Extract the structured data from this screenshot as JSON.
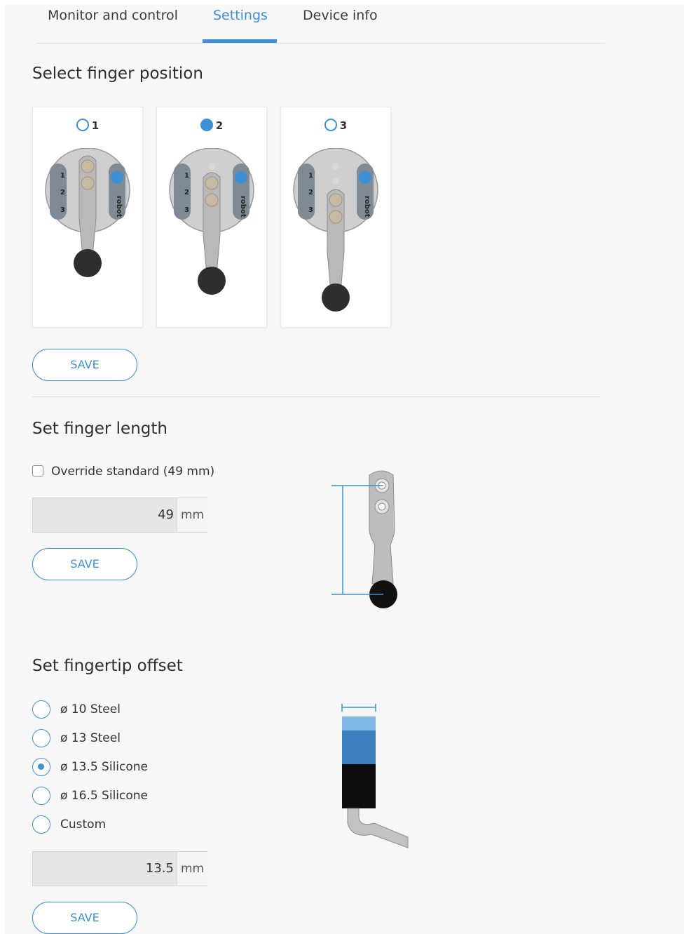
{
  "tabs": [
    {
      "label": "Monitor and control",
      "active": false
    },
    {
      "label": "Settings",
      "active": true
    },
    {
      "label": "Device info",
      "active": false
    }
  ],
  "finger_position": {
    "title": "Select finger position",
    "options": [
      {
        "label": "1",
        "selected": false,
        "brand": "robot"
      },
      {
        "label": "2",
        "selected": true,
        "brand": "robot"
      },
      {
        "label": "3",
        "selected": false,
        "brand": "robot"
      }
    ],
    "save_label": "SAVE"
  },
  "finger_length": {
    "title": "Set finger length",
    "override_label": "Override standard (49 mm)",
    "override_checked": false,
    "value": "49",
    "unit": "mm",
    "save_label": "SAVE"
  },
  "fingertip_offset": {
    "title": "Set fingertip offset",
    "options": [
      {
        "label": "ø 10 Steel",
        "selected": false
      },
      {
        "label": "ø 13 Steel",
        "selected": false
      },
      {
        "label": "ø 13.5 Silicone",
        "selected": true
      },
      {
        "label": "ø 16.5 Silicone",
        "selected": false
      },
      {
        "label": "Custom",
        "selected": false
      }
    ],
    "value": "13.5",
    "unit": "mm",
    "save_label": "SAVE"
  },
  "colors": {
    "accent": "#3d8fd6",
    "panel_bg": "#f7f7f7",
    "input_bg": "#e6e6e6"
  }
}
